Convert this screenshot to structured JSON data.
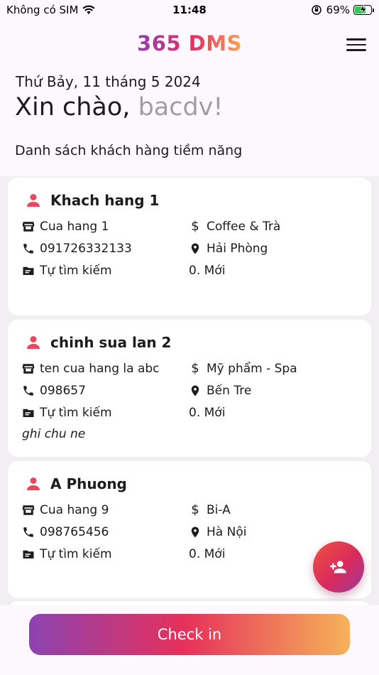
{
  "status": {
    "carrier": "Không có SIM",
    "time": "11:48",
    "battery": "69%",
    "battery_level": 0.69
  },
  "header": {
    "brand": "365 DMS",
    "date": "Thứ Bảy, 11 tháng 5 2024",
    "greeting": "Xin chào, ",
    "username": "bacdv!",
    "section_title": "Danh sách khách hàng tiềm năng"
  },
  "customers": [
    {
      "name": "Khach hang 1",
      "store": "Cua hang 1",
      "category": "Coffee & Trà",
      "phone": "091726332133",
      "location": "Hải Phòng",
      "source": "Tự tìm kiếm",
      "status": "0. Mới",
      "note": ""
    },
    {
      "name": "chinh sua lan 2",
      "store": "ten cua hang la abc",
      "category": "Mỹ phẩm - Spa",
      "phone": "098657",
      "location": "Bến Tre",
      "source": "Tự tìm kiếm",
      "status": "0. Mới",
      "note": "ghi chu ne"
    },
    {
      "name": "A Phuong",
      "store": "Cua hang 9",
      "category": "Bi-A",
      "phone": "098765456",
      "location": "Hà Nội",
      "source": "Tự tìm kiếm",
      "status": "0. Mới",
      "note": ""
    }
  ],
  "actions": {
    "checkin_label": "Check in",
    "currency_symbol": "$"
  },
  "colors": {
    "accent_purple": "#8c43b1",
    "accent_red": "#e6305b",
    "accent_orange": "#f6b25a",
    "user_icon": "#e8475f"
  }
}
